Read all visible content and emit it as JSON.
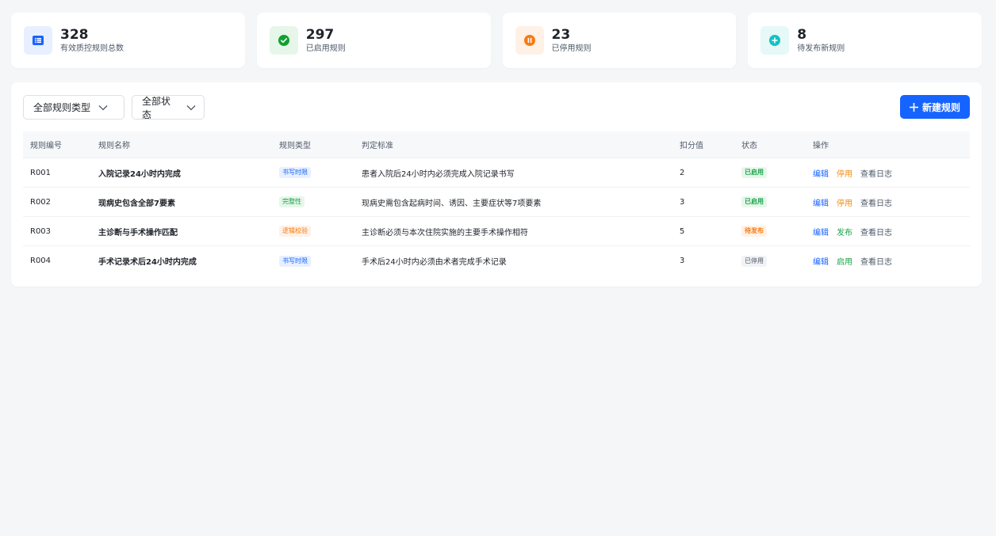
{
  "stats": [
    {
      "value": "328",
      "label": "有效质控规则总数",
      "icon": "list-icon",
      "bg": "#e8efff",
      "fg": "#1664ff"
    },
    {
      "value": "297",
      "label": "已启用规则",
      "icon": "check-circle-icon",
      "bg": "#e6f7ea",
      "fg": "#12a12f"
    },
    {
      "value": "23",
      "label": "已停用规则",
      "icon": "pause-circle-icon",
      "bg": "#fff1e6",
      "fg": "#f77b12"
    },
    {
      "value": "8",
      "label": "待发布新规则",
      "icon": "plus-circle-icon",
      "bg": "#e6f8f8",
      "fg": "#14c2c2"
    }
  ],
  "filters": {
    "type_select": "全部规则类型",
    "status_select": "全部状态"
  },
  "toolbar": {
    "new_label": "新建规则"
  },
  "table": {
    "headers": [
      "规则编号",
      "规则名称",
      "规则类型",
      "判定标准",
      "扣分值",
      "状态",
      "操作"
    ],
    "rows": [
      {
        "id": "R001",
        "name": "入院记录24小时内完成",
        "type": "书写时限",
        "type_color": "blue",
        "standard": "患者入院后24小时内必须完成入院记录书写",
        "score": "2",
        "status": "已启用",
        "status_color": "green",
        "actions": [
          {
            "label": "编辑",
            "color": "blue"
          },
          {
            "label": "停用",
            "color": "orange"
          },
          {
            "label": "查看日志",
            "color": "gray"
          }
        ]
      },
      {
        "id": "R002",
        "name": "现病史包含全部7要素",
        "type": "完整性",
        "type_color": "green",
        "standard": "现病史需包含起病时间、诱因、主要症状等7项要素",
        "score": "3",
        "status": "已启用",
        "status_color": "green",
        "actions": [
          {
            "label": "编辑",
            "color": "blue"
          },
          {
            "label": "停用",
            "color": "orange"
          },
          {
            "label": "查看日志",
            "color": "gray"
          }
        ]
      },
      {
        "id": "R003",
        "name": "主诊断与手术操作匹配",
        "type": "逻辑校验",
        "type_color": "orange",
        "standard": "主诊断必须与本次住院实施的主要手术操作相符",
        "score": "5",
        "status": "待发布",
        "status_color": "orange",
        "actions": [
          {
            "label": "编辑",
            "color": "blue"
          },
          {
            "label": "发布",
            "color": "green"
          },
          {
            "label": "查看日志",
            "color": "gray"
          }
        ]
      },
      {
        "id": "R004",
        "name": "手术记录术后24小时内完成",
        "type": "书写时限",
        "type_color": "blue",
        "standard": "手术后24小时内必须由术者完成手术记录",
        "score": "3",
        "status": "已停用",
        "status_color": "gray",
        "actions": [
          {
            "label": "编辑",
            "color": "blue"
          },
          {
            "label": "启用",
            "color": "green"
          },
          {
            "label": "查看日志",
            "color": "gray"
          }
        ]
      }
    ]
  }
}
